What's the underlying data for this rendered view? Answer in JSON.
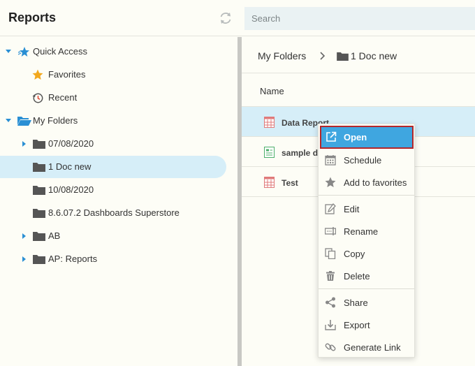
{
  "header": {
    "title": "Reports",
    "search_placeholder": "Search"
  },
  "sidebar": {
    "quick_access": {
      "label": "Quick Access",
      "items": [
        {
          "label": "Favorites"
        },
        {
          "label": "Recent"
        }
      ]
    },
    "my_folders": {
      "label": "My Folders",
      "items": [
        {
          "label": "07/08/2020"
        },
        {
          "label": "1 Doc new"
        },
        {
          "label": "10/08/2020"
        },
        {
          "label": "8.6.07.2 Dashboards Superstore"
        },
        {
          "label": "AB"
        },
        {
          "label": "AP: Reports"
        }
      ]
    }
  },
  "main": {
    "breadcrumb": {
      "root": "My Folders",
      "current": "1 Doc new"
    },
    "column_name": "Name",
    "files": [
      {
        "label": "Data Report"
      },
      {
        "label": "sample d"
      },
      {
        "label": "Test"
      }
    ]
  },
  "context_menu": {
    "items": [
      {
        "label": "Open"
      },
      {
        "label": "Schedule"
      },
      {
        "label": "Add to favorites"
      },
      {
        "label": "Edit"
      },
      {
        "label": "Rename"
      },
      {
        "label": "Copy"
      },
      {
        "label": "Delete"
      },
      {
        "label": "Share"
      },
      {
        "label": "Export"
      },
      {
        "label": "Generate Link"
      }
    ]
  },
  "colors": {
    "accent": "#3fa6e0",
    "selection": "#d6eef8",
    "folder": "#555555",
    "expander": "#2a8fd4",
    "star": "#f2a81d",
    "active_outline": "#b3262a"
  }
}
